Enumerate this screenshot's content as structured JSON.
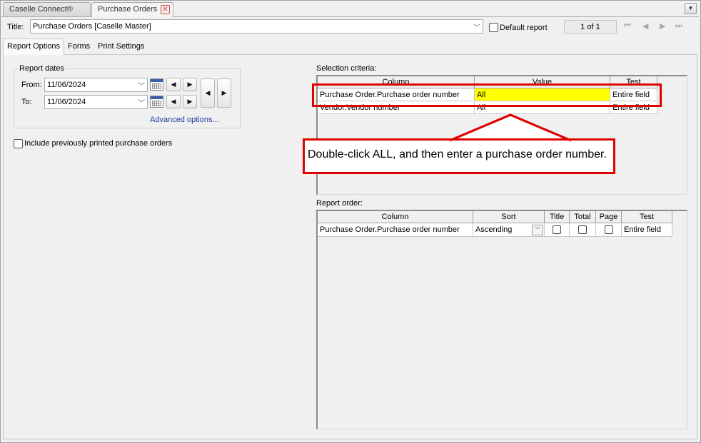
{
  "doc_tabs": [
    {
      "label": "Caselle Connect®"
    },
    {
      "label": "Purchase Orders"
    }
  ],
  "title_row": {
    "label": "Title:",
    "value": "Purchase Orders [Caselle Master]",
    "default_report_label": "Default report",
    "page_indicator": "1 of 1"
  },
  "sub_tabs": [
    {
      "label": "Report Options"
    },
    {
      "label": "Forms"
    },
    {
      "label": "Print Settings"
    }
  ],
  "report_dates": {
    "legend": "Report dates",
    "from_label": "From:",
    "from_value": "11/06/2024",
    "to_label": "To:",
    "to_value": "11/06/2024",
    "advanced_link": "Advanced options..."
  },
  "include_printed_label": "Include previously printed purchase orders",
  "selection_criteria": {
    "label": "Selection criteria:",
    "headers": [
      "Column",
      "Value",
      "Test"
    ],
    "rows": [
      {
        "column": "Purchase Order.Purchase order number",
        "value": "All",
        "test": "Entire field"
      },
      {
        "column": "Vendor.Vendor number",
        "value": "All",
        "test": "Entire field"
      }
    ]
  },
  "callout_text": "Double-click ALL, and then enter a purchase order number.",
  "report_order": {
    "label": "Report order:",
    "headers": [
      "Column",
      "Sort",
      "Title",
      "Total",
      "Page",
      "Test"
    ],
    "rows": [
      {
        "column": "Purchase Order.Purchase order number",
        "sort": "Ascending",
        "title": false,
        "total": false,
        "page": false,
        "test": "Entire field"
      }
    ]
  },
  "colors": {
    "highlight": "#ffff00",
    "callout_border": "#e00000",
    "link": "#1a3b9e"
  }
}
